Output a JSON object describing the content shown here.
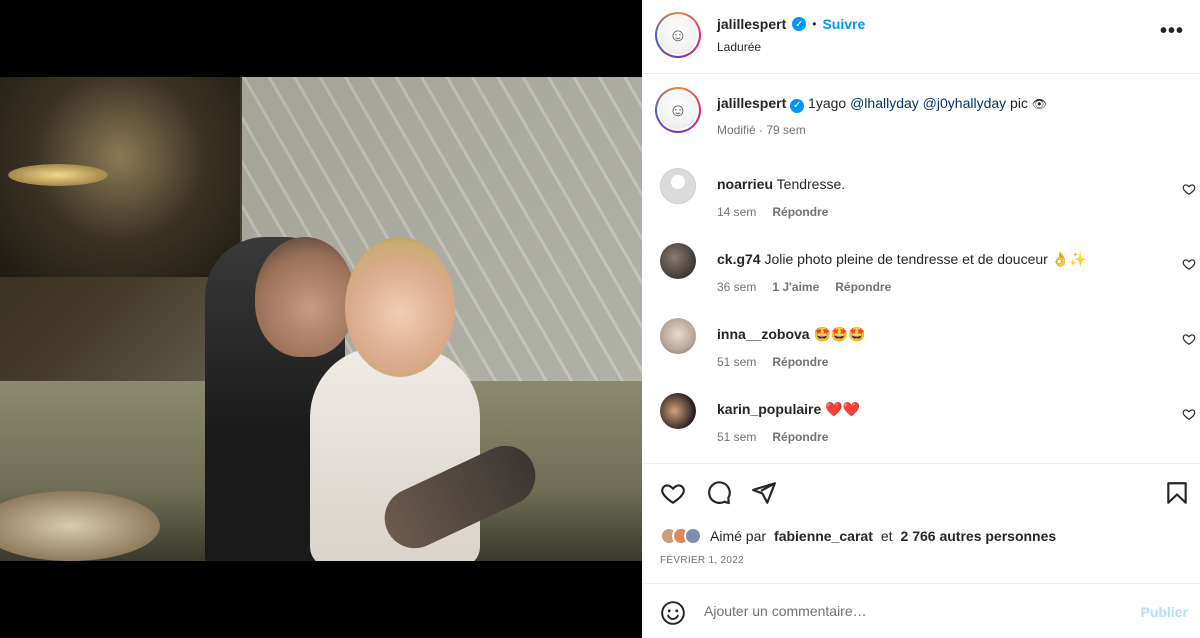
{
  "header": {
    "username": "jalillespert",
    "separator": "•",
    "follow_label": "Suivre",
    "location": "Ladurée",
    "more_label": "•••"
  },
  "caption": {
    "username": "jalillespert",
    "text": "1yago",
    "mention1": "@lhallyday",
    "mention2": "@j0yhallyday",
    "suffix": "pic",
    "meta": "Modifié · 79 sem"
  },
  "comments": [
    {
      "username": "noarrieu",
      "text": "Tendresse.",
      "time": "14 sem",
      "likes": "",
      "reply": "Répondre"
    },
    {
      "username": "ck.g74",
      "text": "Jolie photo pleine de tendresse et de douceur 👌✨",
      "time": "36 sem",
      "likes": "1 J'aime",
      "reply": "Répondre"
    },
    {
      "username": "inna__zobova",
      "text": "🤩🤩🤩",
      "time": "51 sem",
      "likes": "",
      "reply": "Répondre"
    },
    {
      "username": "karin_populaire",
      "text": "❤️❤️",
      "time": "51 sem",
      "likes": "",
      "reply": "Répondre"
    }
  ],
  "likes": {
    "prefix": "Aimé par",
    "user": "fabienne_carat",
    "conj": "et",
    "count": "2 766 autres personnes"
  },
  "date": "FÉVRIER 1, 2022",
  "add_comment": {
    "placeholder": "Ajouter un commentaire…",
    "publish_label": "Publier"
  },
  "icons": {
    "like": "heart-icon",
    "comment": "comment-icon",
    "share": "share-icon",
    "save": "bookmark-icon",
    "emoji": "emoji-icon",
    "verified": "verified-badge-icon"
  },
  "colors": {
    "accent": "#0095f6",
    "mention": "#00376b",
    "muted": "#737373",
    "publish_disabled": "#b2dffc"
  }
}
